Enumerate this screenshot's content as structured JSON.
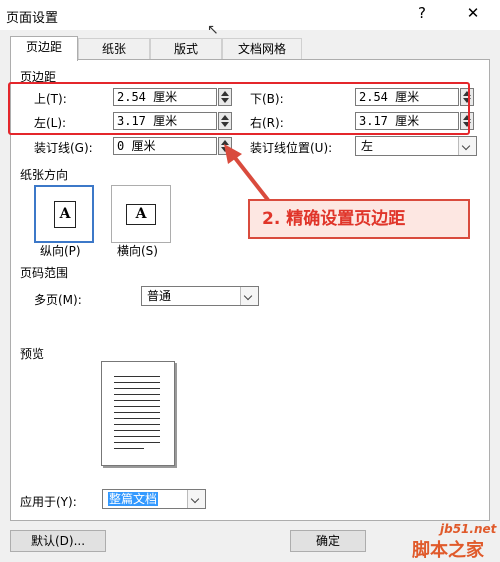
{
  "window": {
    "title": "页面设置",
    "help_label": "?",
    "close_label": "✕"
  },
  "tabs": [
    {
      "label": "页边距",
      "active": true
    },
    {
      "label": "纸张",
      "active": false
    },
    {
      "label": "版式",
      "active": false
    },
    {
      "label": "文档网格",
      "active": false
    }
  ],
  "margins": {
    "section_title": "页边距",
    "top": {
      "label": "上(T):",
      "value": "2.54 厘米"
    },
    "bottom": {
      "label": "下(B):",
      "value": "2.54 厘米"
    },
    "left": {
      "label": "左(L):",
      "value": "3.17 厘米"
    },
    "right": {
      "label": "右(R):",
      "value": "3.17 厘米"
    },
    "gutter": {
      "label": "装订线(G):",
      "value": "0 厘米"
    },
    "gutter_position": {
      "label": "装订线位置(U):",
      "value": "左"
    }
  },
  "orientation": {
    "section_title": "纸张方向",
    "portrait": {
      "label": "纵向(P)",
      "icon_letter": "A",
      "selected": true
    },
    "landscape": {
      "label": "横向(S)",
      "icon_letter": "A",
      "selected": false
    }
  },
  "pages": {
    "section_title": "页码范围",
    "multiple_label": "多页(M):",
    "multiple_value": "普通"
  },
  "preview": {
    "section_title": "预览",
    "apply_label": "应用于(Y):",
    "apply_value": "整篇文档"
  },
  "buttons": {
    "default_label": "默认(D)...",
    "ok_label": "确定"
  },
  "annotation": {
    "text": "2. 精确设置页边距"
  },
  "watermark": {
    "site": "jb51.net",
    "brand": "脚本之家"
  },
  "colors": {
    "highlight": "#e4262b",
    "selection": "#3399ff"
  }
}
